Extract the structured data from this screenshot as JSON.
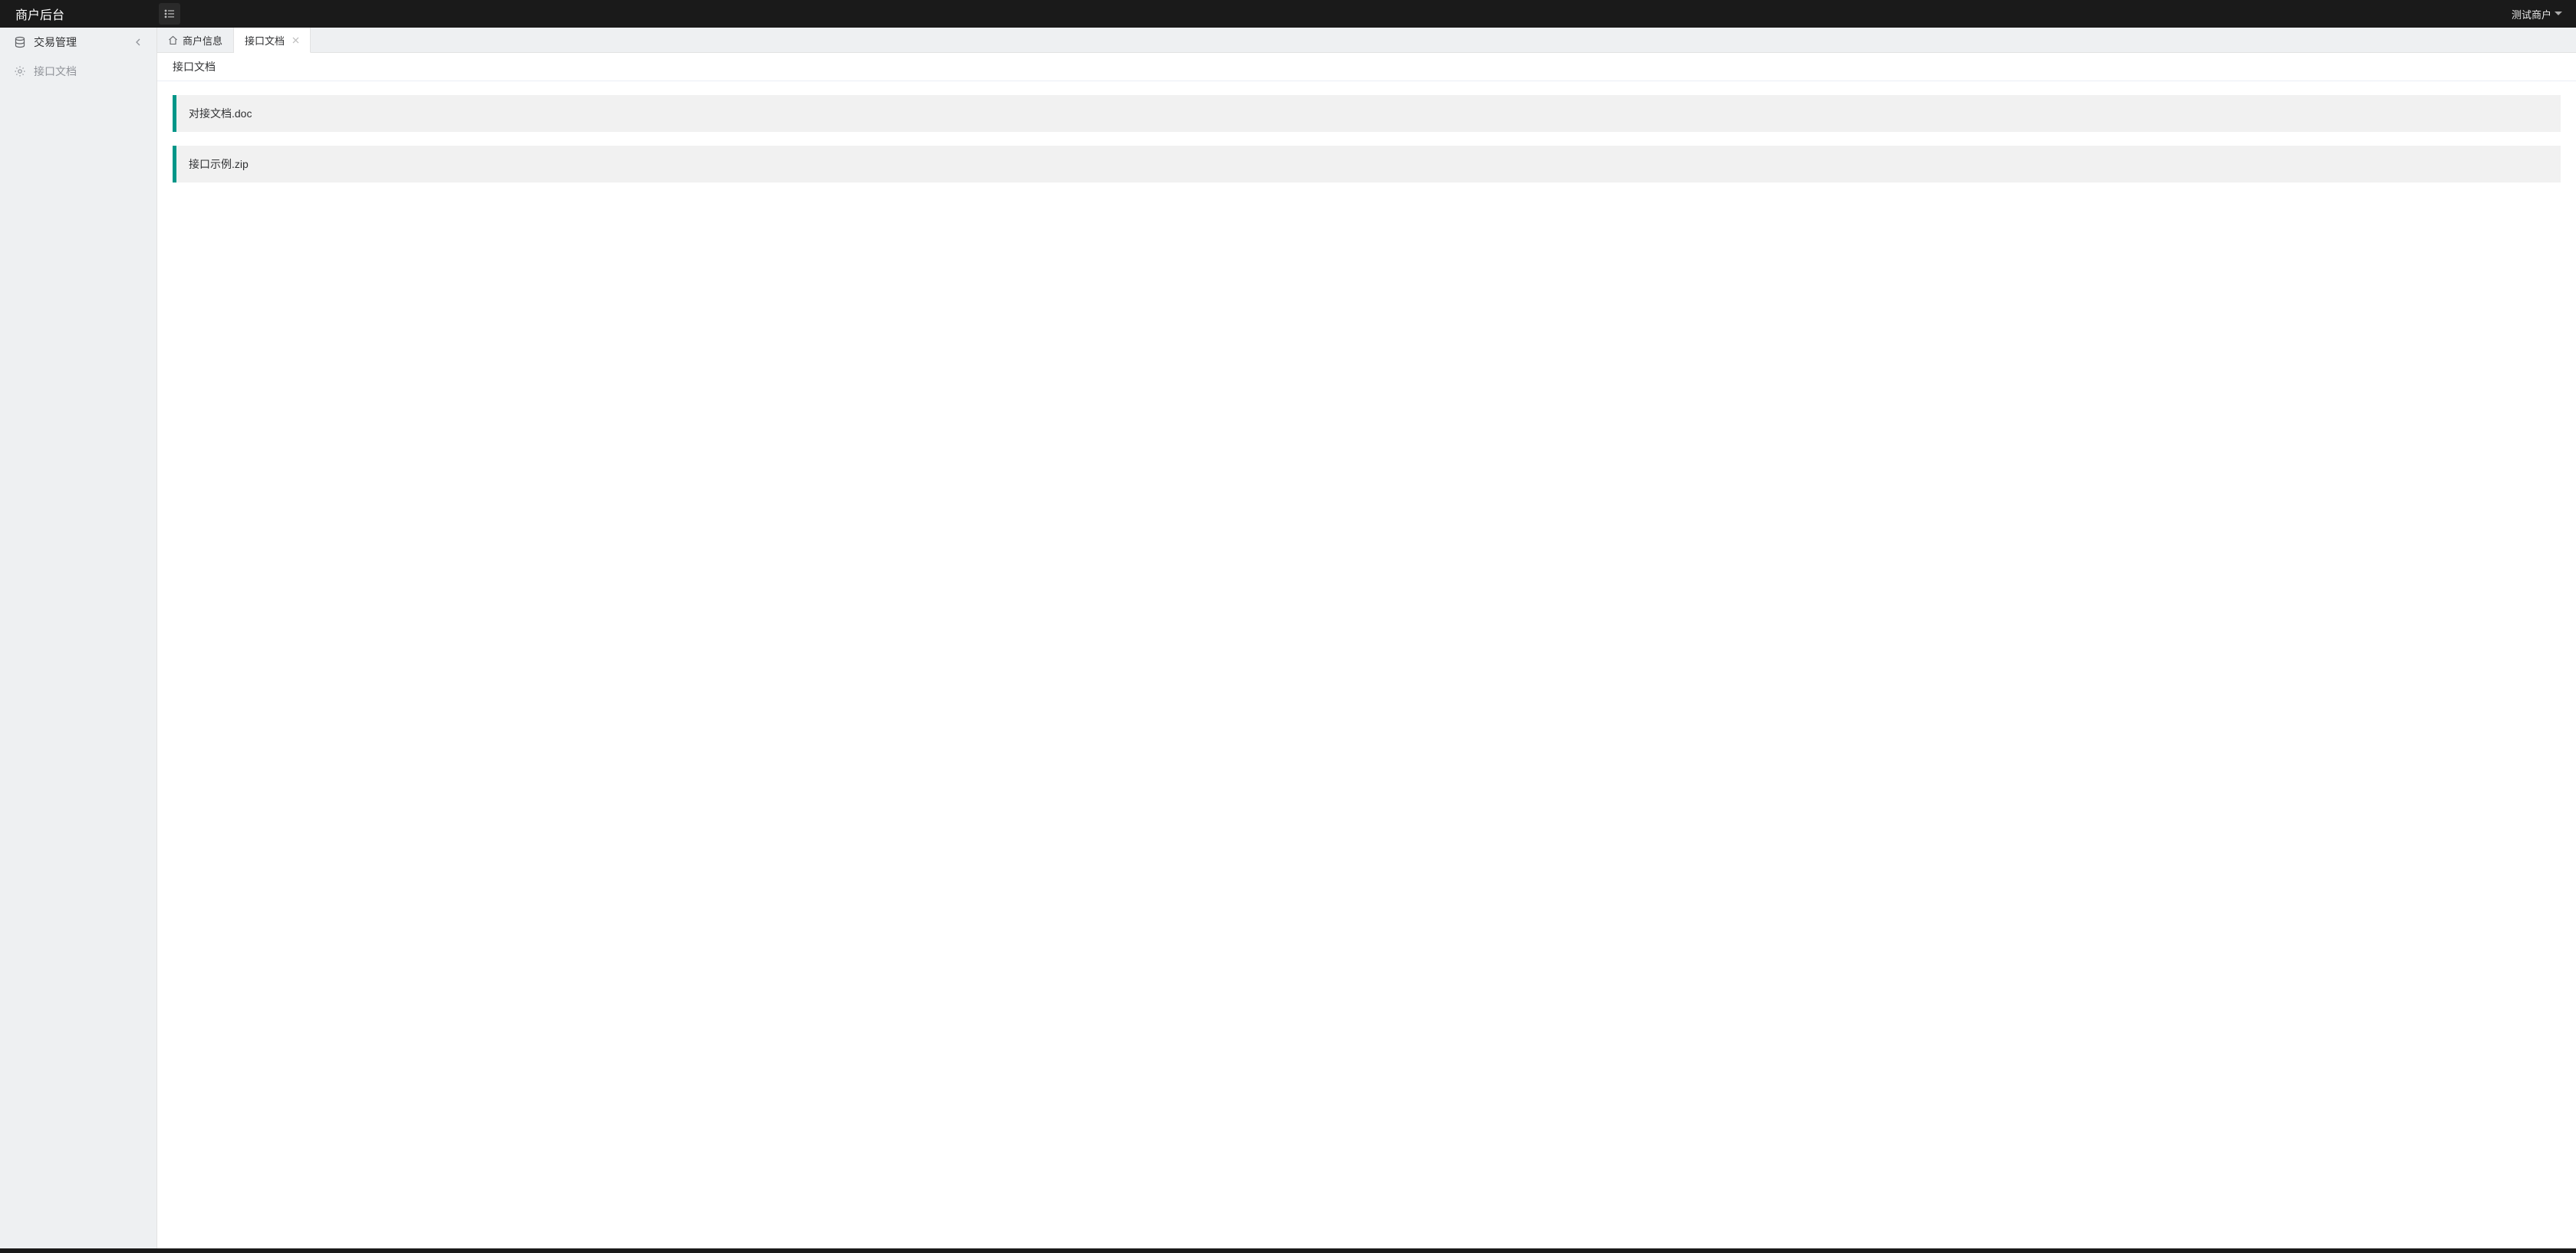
{
  "header": {
    "logo": "商户后台",
    "user_name": "测试商户"
  },
  "sidebar": {
    "items": [
      {
        "label": "交易管理",
        "icon": "database-icon",
        "has_chevron": true,
        "muted": false
      },
      {
        "label": "接口文档",
        "icon": "gear-icon",
        "has_chevron": false,
        "muted": true
      }
    ]
  },
  "tabs": [
    {
      "label": "商户信息",
      "has_home_icon": true,
      "closable": false,
      "active": false
    },
    {
      "label": "接口文档",
      "has_home_icon": false,
      "closable": true,
      "active": true
    }
  ],
  "page": {
    "title": "接口文档",
    "files": [
      {
        "name": "对接文档.doc"
      },
      {
        "name": "接口示例.zip"
      }
    ]
  },
  "colors": {
    "accent": "#009688",
    "header_bg": "#1a1a1a"
  }
}
